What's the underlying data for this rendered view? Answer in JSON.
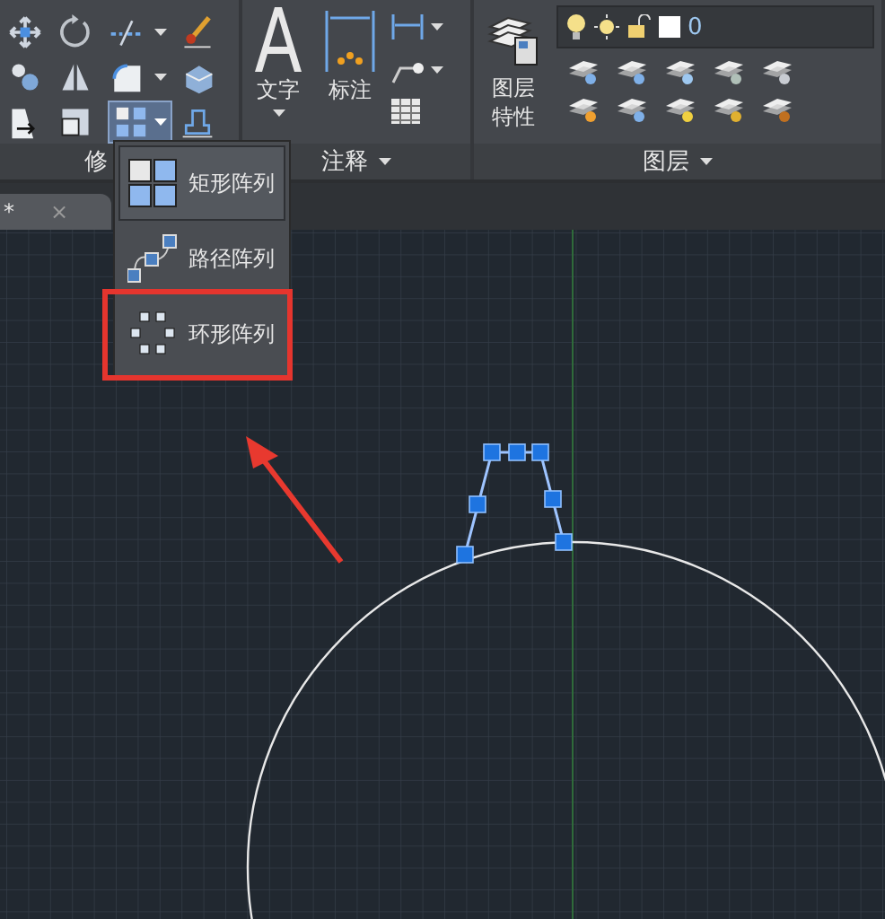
{
  "ribbon": {
    "panels": [
      {
        "kind": "modify",
        "title": "修",
        "array_button": {
          "expanded": true
        }
      },
      {
        "kind": "annotate",
        "title": "注释",
        "buttons": [
          {
            "label": "文字"
          },
          {
            "label": "标注"
          }
        ]
      },
      {
        "kind": "layers",
        "title": "图层",
        "properties_lines": [
          "图层",
          "特性"
        ],
        "layer_value": "0"
      }
    ]
  },
  "document_tab": {
    "label": "*",
    "close": "×"
  },
  "array_menu": {
    "items": [
      {
        "label": "矩形阵列",
        "kind": "rect",
        "selected": true,
        "callout": false
      },
      {
        "label": "路径阵列",
        "kind": "path",
        "selected": false,
        "callout": false
      },
      {
        "label": "环形阵列",
        "kind": "polar",
        "selected": false,
        "callout": true
      }
    ]
  }
}
